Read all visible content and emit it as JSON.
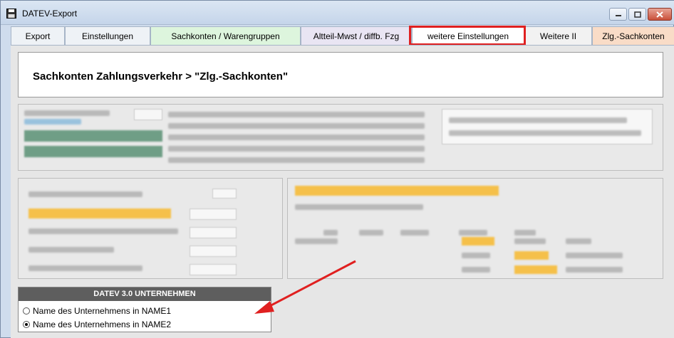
{
  "window": {
    "title": "DATEV-Export"
  },
  "tabs": [
    {
      "label": "Export"
    },
    {
      "label": "Einstellungen"
    },
    {
      "label": "Sachkonten / Warengruppen"
    },
    {
      "label": "Altteil-Mwst / diffb. Fzg"
    },
    {
      "label": "weitere Einstellungen"
    },
    {
      "label": "Weitere II"
    },
    {
      "label": "Zlg.-Sachkonten"
    }
  ],
  "header": {
    "title": "Sachkonten Zahlungsverkehr > \"Zlg.-Sachkonten\""
  },
  "datev_group": {
    "heading": "DATEV 3.0 UNTERNEHMEN",
    "options": [
      {
        "label": "Name des Unternehmens in NAME1",
        "selected": false
      },
      {
        "label": "Name des Unternehmens in NAME2",
        "selected": true
      }
    ]
  },
  "colors": {
    "highlight_border": "#e02020",
    "arrow": "#e02020",
    "panel_header": "#5e5e5e"
  }
}
